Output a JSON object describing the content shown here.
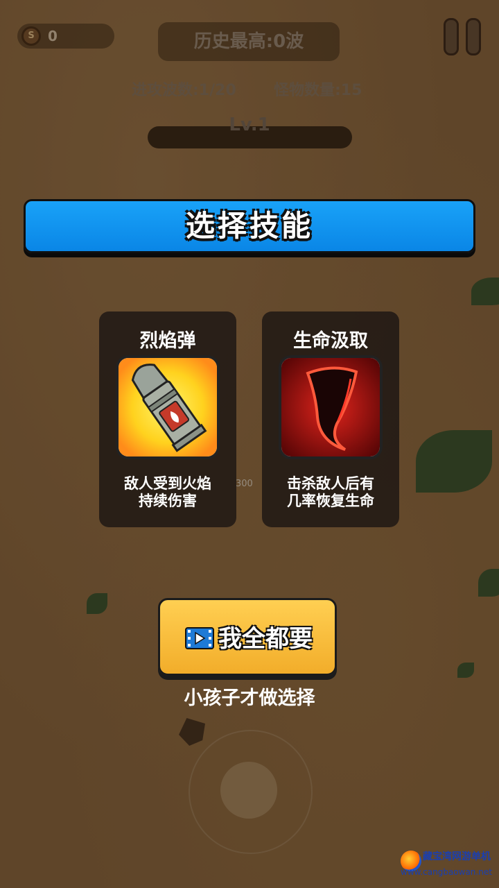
{
  "hud": {
    "coin_symbol": "S",
    "coins": "0",
    "best_record": "历史最高:0波",
    "wave": "进攻波数:1/20",
    "monsters": "怪物数量:15",
    "level": "Lv.1",
    "turret_hp": "300"
  },
  "dialog": {
    "title": "选择技能",
    "skills": [
      {
        "name": "烈焰弹",
        "desc": "敌人受到火焰\n持续伤害",
        "icon": "fire-bullet-icon"
      },
      {
        "name": "生命汲取",
        "desc": "击杀敌人后有\n几率恢复生命",
        "icon": "life-drain-fang-icon"
      }
    ],
    "want_all_label": "我全都要",
    "want_all_icon": "video-ad-icon",
    "subtitle": "小孩子才做选择"
  },
  "watermark": {
    "top": "藏宝湾网游单机",
    "bottom": "www.cangbaowan.net"
  },
  "colors": {
    "banner": "#0a86e6",
    "button": "#f2ad2a"
  }
}
